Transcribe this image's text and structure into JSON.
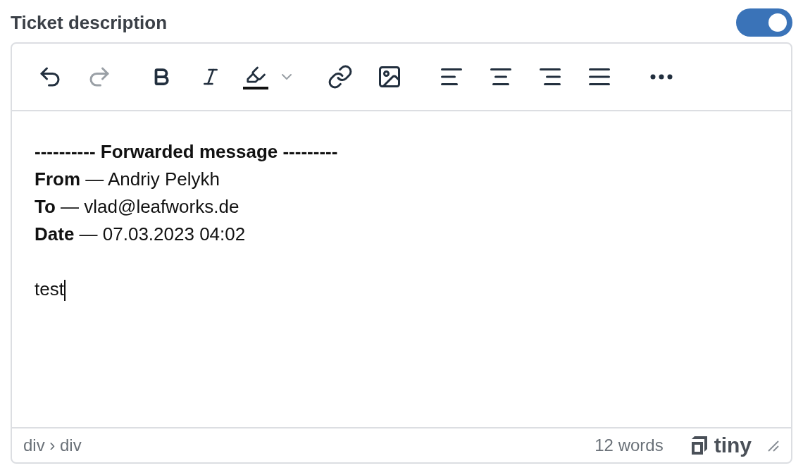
{
  "field": {
    "label": "Ticket description",
    "toggle": {
      "on": true
    }
  },
  "toolbar": {
    "groups": [
      [
        {
          "kind": "undo",
          "disabled": false
        },
        {
          "kind": "redo",
          "disabled": true
        }
      ],
      [
        {
          "kind": "bold",
          "disabled": false
        },
        {
          "kind": "italic",
          "disabled": false
        },
        {
          "kind": "highlight",
          "disabled": false
        }
      ],
      [
        {
          "kind": "link",
          "disabled": false
        },
        {
          "kind": "image",
          "disabled": false
        }
      ],
      [
        {
          "kind": "align-left",
          "disabled": false
        },
        {
          "kind": "align-center",
          "disabled": false
        },
        {
          "kind": "align-right",
          "disabled": false
        },
        {
          "kind": "align-justify",
          "disabled": false
        }
      ],
      [
        {
          "kind": "more",
          "disabled": false
        }
      ]
    ]
  },
  "content": [
    {
      "kind": "heading",
      "text": "---------- Forwarded message ---------"
    },
    {
      "kind": "line",
      "text": "**From** — Andriy Pelykh"
    },
    {
      "kind": "line",
      "text": "**To** — vlad@leafworks.de"
    },
    {
      "kind": "line",
      "text": "**Date** — 07.03.2023 04:02"
    },
    {
      "kind": "blank"
    },
    {
      "kind": "cursor-line",
      "text": "test"
    }
  ],
  "status_bar": {
    "path": "div › div",
    "word_count": "12 words",
    "brand": "tiny"
  }
}
